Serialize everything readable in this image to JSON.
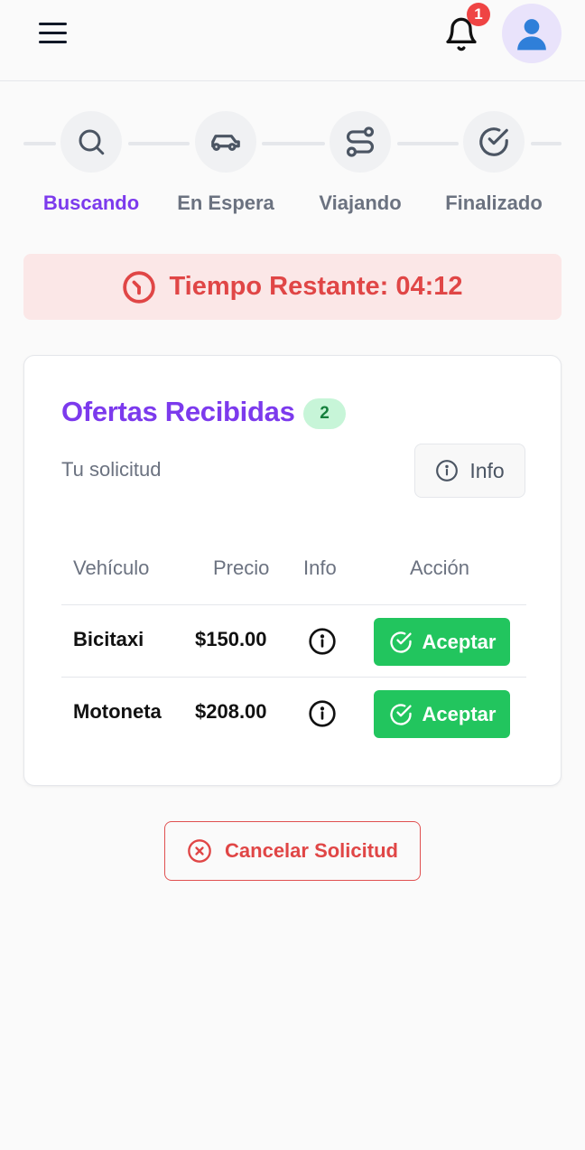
{
  "header": {
    "notification_count": "1",
    "avatar_glyph": "👤"
  },
  "stepper": {
    "steps": [
      {
        "label": "Buscando",
        "icon": "search-icon",
        "active": true
      },
      {
        "label": "En Espera",
        "icon": "car-icon",
        "active": false
      },
      {
        "label": "Viajando",
        "icon": "route-icon",
        "active": false
      },
      {
        "label": "Finalizado",
        "icon": "check-circle-icon",
        "active": false
      }
    ]
  },
  "timer": {
    "label": "Tiempo Restante: 04:12"
  },
  "offers": {
    "title": "Ofertas Recibidas",
    "count": "2",
    "subtitle": "Tu solicitud",
    "info_button": "Info",
    "columns": [
      "Vehículo",
      "Precio",
      "Info",
      "Acción"
    ],
    "rows": [
      {
        "vehicle": "Bicitaxi",
        "price": "$150.00",
        "action": "Aceptar"
      },
      {
        "vehicle": "Motoneta",
        "price": "$208.00",
        "action": "Aceptar"
      }
    ]
  },
  "cancel": {
    "label": "Cancelar Solicitud"
  },
  "colors": {
    "accent": "#7c3aed",
    "danger": "#e04646",
    "success": "#22c55e",
    "timer_bg": "#fbe7e7"
  }
}
